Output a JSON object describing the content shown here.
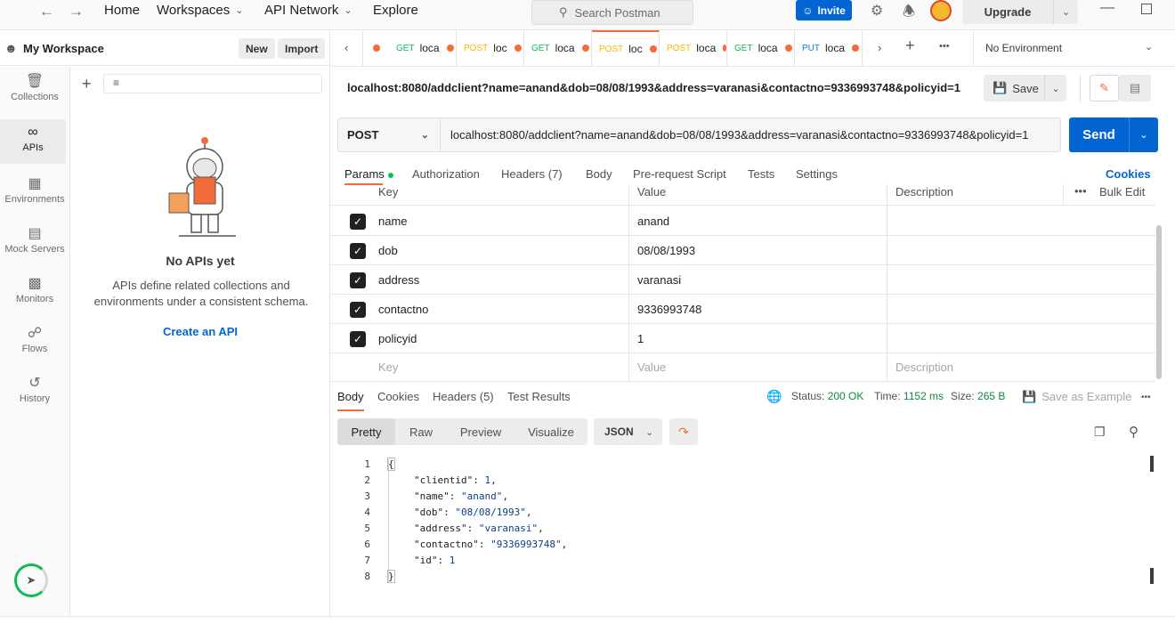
{
  "topbar": {
    "nav": [
      "Home",
      "Workspaces",
      "API Network",
      "Explore"
    ],
    "search_placeholder": "Search Postman",
    "invite": "Invite",
    "upgrade": "Upgrade"
  },
  "sidebar": {
    "workspace": "My Workspace",
    "new": "New",
    "import": "Import",
    "rail": [
      "Collections",
      "APIs",
      "Environments",
      "Mock Servers",
      "Monitors",
      "Flows",
      "History"
    ],
    "empty_title": "No APIs yet",
    "empty_desc": "APIs define related collections and environments under a consistent schema.",
    "create_api": "Create an API"
  },
  "tabs": [
    {
      "method": "GET",
      "name": "loca",
      "color": "#0cbb52"
    },
    {
      "method": "POST",
      "name": "loc",
      "color": "#ffb400"
    },
    {
      "method": "GET",
      "name": "loca",
      "color": "#0cbb52"
    },
    {
      "method": "POST",
      "name": "loc",
      "color": "#ffb400"
    },
    {
      "method": "POST",
      "name": "loca",
      "color": "#ffb400"
    },
    {
      "method": "GET",
      "name": "loca",
      "color": "#0cbb52"
    },
    {
      "method": "PUT",
      "name": "loca",
      "color": "#097bed"
    }
  ],
  "environment": "No Environment",
  "request": {
    "title": "localhost:8080/addclient?name=anand&dob=08/08/1993&address=varanasi&contactno=9336993748&policyid=1",
    "save": "Save",
    "method": "POST",
    "url": "localhost:8080/addclient?name=anand&dob=08/08/1993&address=varanasi&contactno=9336993748&policyid=1",
    "send": "Send",
    "subtabs": [
      "Params",
      "Authorization",
      "Headers (7)",
      "Body",
      "Pre-request Script",
      "Tests",
      "Settings"
    ],
    "cookies": "Cookies"
  },
  "params": {
    "headers": [
      "Key",
      "Value",
      "Description",
      "Bulk Edit"
    ],
    "rows": [
      {
        "key": "name",
        "value": "anand"
      },
      {
        "key": "dob",
        "value": "08/08/1993"
      },
      {
        "key": "address",
        "value": "varanasi"
      },
      {
        "key": "contactno",
        "value": "9336993748"
      },
      {
        "key": "policyid",
        "value": "1"
      }
    ],
    "placeholder": {
      "key": "Key",
      "value": "Value",
      "description": "Description"
    }
  },
  "response": {
    "tabs": [
      "Body",
      "Cookies",
      "Headers (5)",
      "Test Results"
    ],
    "status_label": "Status:",
    "status": "200 OK",
    "time_label": "Time:",
    "time": "1152 ms",
    "size_label": "Size:",
    "size": "265 B",
    "save_example": "Save as Example",
    "formats": [
      "Pretty",
      "Raw",
      "Preview",
      "Visualize"
    ],
    "lang": "JSON",
    "lines": [
      "1",
      "2",
      "3",
      "4",
      "5",
      "6",
      "7",
      "8"
    ],
    "json": {
      "open": "{",
      "close": "}",
      "entries": [
        {
          "k": "\"clientid\"",
          "v": "1",
          "t": "n"
        },
        {
          "k": "\"name\"",
          "v": "\"anand\"",
          "t": "s"
        },
        {
          "k": "\"dob\"",
          "v": "\"08/08/1993\"",
          "t": "s"
        },
        {
          "k": "\"address\"",
          "v": "\"varanasi\"",
          "t": "s"
        },
        {
          "k": "\"contactno\"",
          "v": "\"9336993748\"",
          "t": "s"
        },
        {
          "k": "\"id\"",
          "v": "1",
          "t": "n"
        }
      ]
    }
  }
}
